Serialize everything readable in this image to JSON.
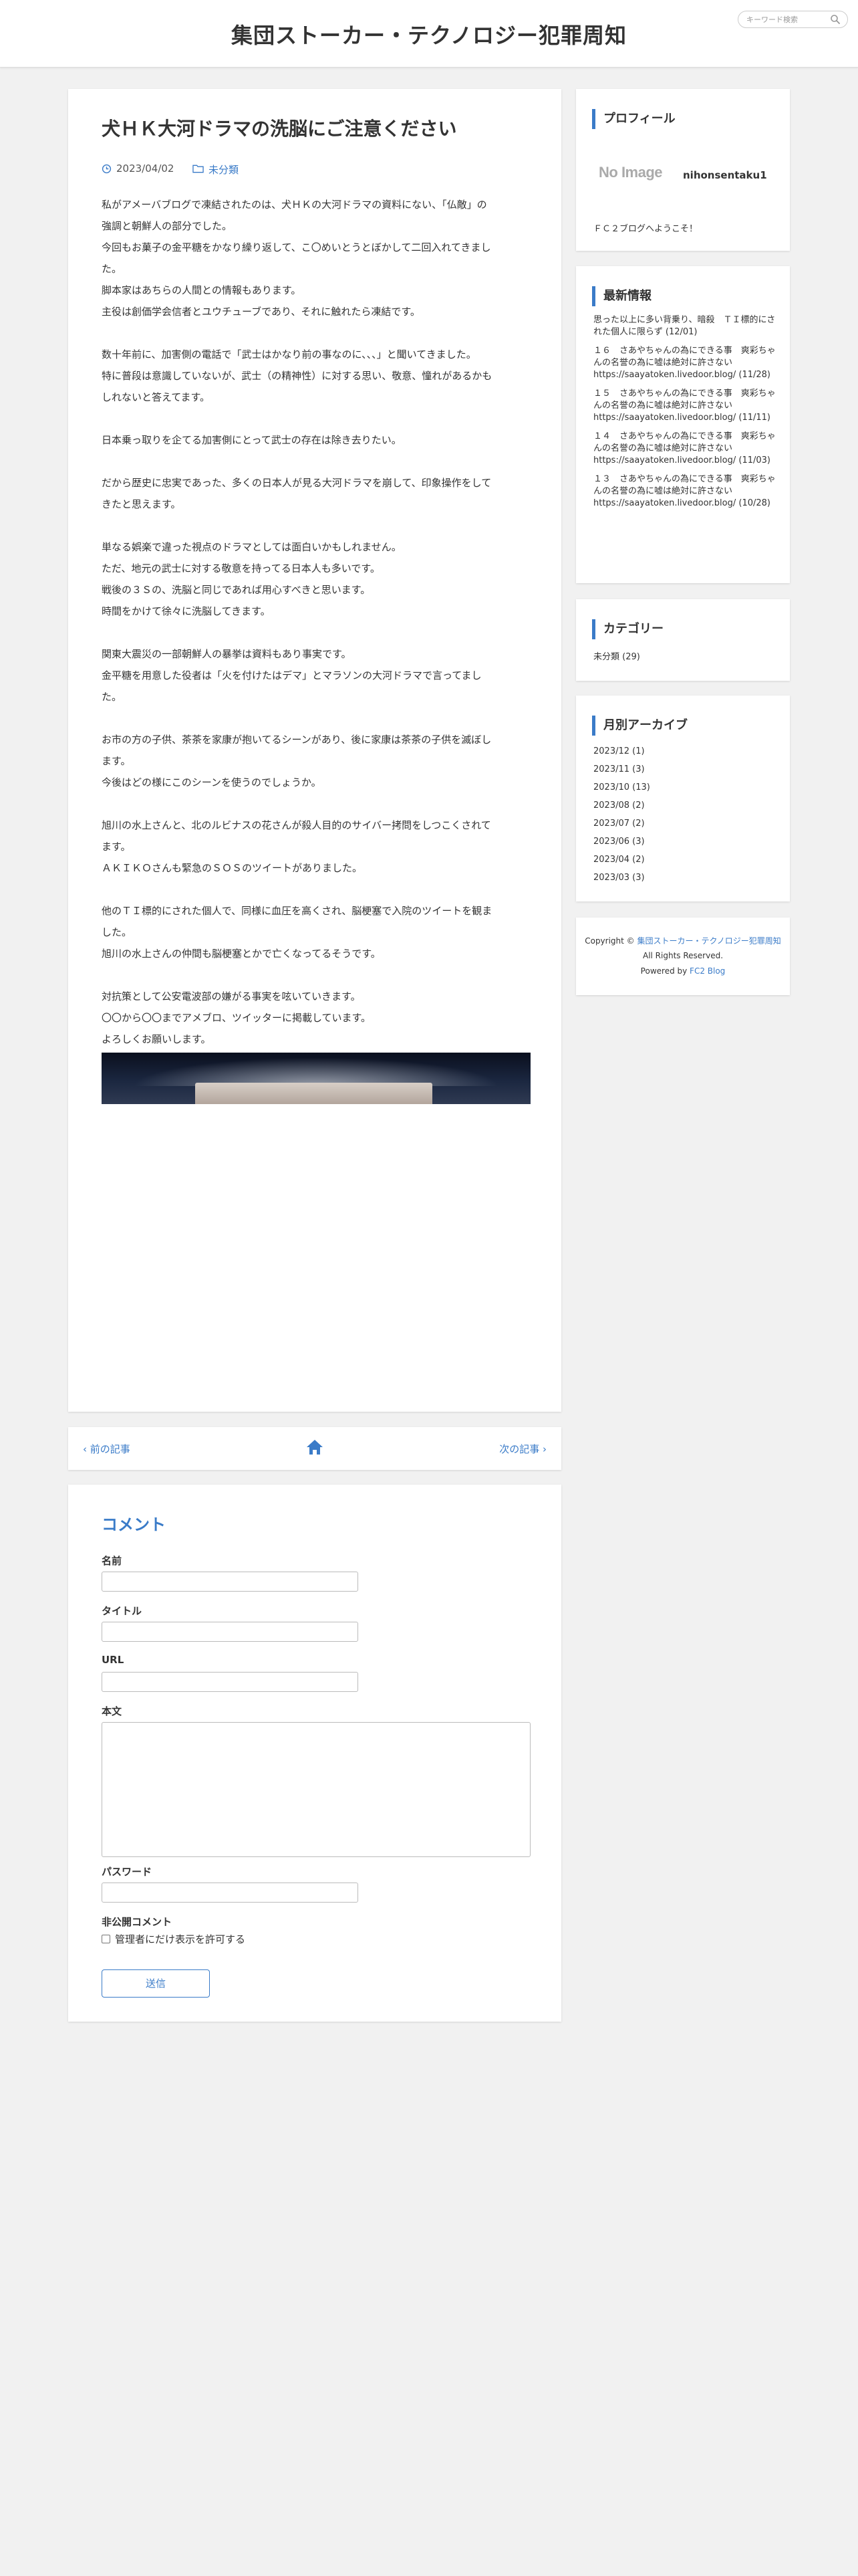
{
  "header": {
    "site_title": "集団ストーカー・テクノロジー犯罪周知",
    "search_placeholder": "キーワード検索"
  },
  "article": {
    "title": "犬ＨＫ大河ドラマの洗脳にご注意ください",
    "date": "2023/04/02",
    "category": "未分類",
    "paragraphs": [
      [
        "私がアメーバブログで凍結されたのは、犬ＨＫの大河ドラマの資料にない、「仏敵」の",
        "強調と朝鮮人の部分でした。",
        "今回もお菓子の金平糖をかなり繰り返して、こ〇めいとうとぼかして二回入れてきまし",
        "た。",
        "脚本家はあちらの人間との情報もあります。",
        "主役は創価学会信者とユウチューブであり、それに触れたら凍結です。"
      ],
      [
        "数十年前に、加害側の電話で「武士はかなり前の事なのに、、、」と聞いてきました。",
        "特に普段は意識していないが、武士（の精神性）に対する思い、敬意、憧れがあるかも",
        "しれないと答えてます。"
      ],
      [
        "日本乗っ取りを企てる加害側にとって武士の存在は除き去りたい。"
      ],
      [
        "だから歴史に忠実であった、多くの日本人が見る大河ドラマを崩して、印象操作をして",
        "きたと思えます。"
      ],
      [
        "単なる娯楽で違った視点のドラマとしては面白いかもしれません。",
        "ただ、地元の武士に対する敬意を持ってる日本人も多いです。",
        "戦後の３Ｓの、洗脳と同じであれば用心すべきと思います。",
        "時間をかけて徐々に洗脳してきます。"
      ],
      [
        "関東大震災の一部朝鮮人の暴挙は資料もあり事実です。",
        "金平糖を用意した役者は「火を付けたはデマ」とマラソンの大河ドラマで言ってまし",
        "た。"
      ],
      [
        "お市の方の子供、茶茶を家康が抱いてるシーンがあり、後に家康は茶茶の子供を滅ぼし",
        "ます。",
        "今後はどの様にこのシーンを使うのでしょうか。"
      ],
      [
        "旭川の水上さんと、北のルビナスの花さんが殺人目的のサイバー拷問をしつこくされて",
        "ます。",
        "ＡＫＩＫＯさんも緊急のＳＯＳのツイートがありました。"
      ],
      [
        "他のＴＩ標的にされた個人で、同様に血圧を高くされ、脳梗塞で入院のツイートを観ま",
        "した。",
        "旭川の水上さんの仲間も脳梗塞とかで亡くなってるそうです。"
      ],
      [
        "対抗策として公安電波部の嫌がる事実を呟いていきます。",
        "〇〇から〇〇までアメブロ、ツイッターに掲載しています。",
        "よろしくお願いします。"
      ]
    ]
  },
  "pager": {
    "prev_label": "前の記事",
    "next_label": "次の記事",
    "home_icon": "home-icon"
  },
  "comments": {
    "heading": "コメント",
    "name_label": "名前",
    "title_label": "タイトル",
    "url_label": "URL",
    "body_label": "本文",
    "password_label": "パスワード",
    "private_label": "非公開コメント",
    "private_checkbox_label": "管理者にだけ表示を許可する",
    "submit_label": "送信"
  },
  "sidebar": {
    "profile": {
      "title": "プロフィール",
      "image_placeholder": "No Image",
      "name": "nihonsentaku1",
      "text": "ＦＣ２ブログへようこそ！"
    },
    "recent": {
      "title": "最新情報",
      "items": [
        "思った以上に多い背乗り、暗殺　ＴＩ標的にされた個人に限らず (12/01)",
        "１６　さあやちゃんの為にできる事　爽彩ちゃんの名誉の為に嘘は絶対に許さないhttps://saayatoken.livedoor.blog/ (11/28)",
        "１５　さあやちゃんの為にできる事　爽彩ちゃんの名誉の為に嘘は絶対に許さないhttps://saayatoken.livedoor.blog/ (11/11)",
        "１４　さあやちゃんの為にできる事　爽彩ちゃんの名誉の為に嘘は絶対に許さないhttps://saayatoken.livedoor.blog/ (11/03)",
        "１３　さあやちゃんの為にできる事　爽彩ちゃんの名誉の為に嘘は絶対に許さないhttps://saayatoken.livedoor.blog/ (10/28)"
      ]
    },
    "category": {
      "title": "カテゴリー",
      "items": [
        "未分類 (29)"
      ]
    },
    "archive": {
      "title": "月別アーカイブ",
      "items": [
        "2023/12 (1)",
        "2023/11 (3)",
        "2023/10 (13)",
        "2023/08 (2)",
        "2023/07 (2)",
        "2023/06 (3)",
        "2023/04 (2)",
        "2023/03 (3)"
      ]
    }
  },
  "footer": {
    "copyright_prefix": "Copyright © ",
    "copyright_link": "集団ストーカー・テクノロジー犯罪周知",
    "rights": "All Rights Reserved.",
    "powered_prefix": "Powered by ",
    "powered_link": "FC2 Blog"
  },
  "colors": {
    "accent": "#3a7bc8",
    "background": "#f1f1f1",
    "card": "#ffffff"
  }
}
